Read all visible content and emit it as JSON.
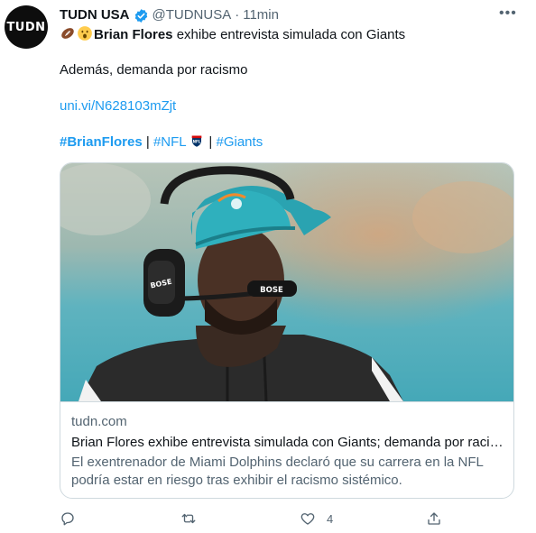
{
  "tweet": {
    "avatar_text": "TUDN",
    "author_name": "TUDN USA",
    "handle": "@TUDNUSA",
    "separator": "·",
    "time": "11min",
    "headline_bold": "Brian Flores",
    "headline_rest": " exhibe entrevista simulada con Giants",
    "body": "Además, demanda por racismo",
    "link": "uni.vi/N628103mZjt",
    "hashtags": [
      "#BrianFlores",
      "#NFL",
      "#Giants"
    ],
    "tag_separator": "|",
    "icons": [
      "verified-badge-icon",
      "football-emoji-icon",
      "surprised-face-emoji-icon",
      "nfl-shield-emoji-icon",
      "more-options-icon"
    ]
  },
  "card": {
    "domain": "tudn.com",
    "title": "Brian Flores exhibe entrevista simulada con Giants; demanda por racismo",
    "description": "El exentrenador de Miami Dolphins declaró que su carrera en la NFL podría estar en riesgo tras exhibir el racismo sistémico.",
    "image_desc": "coach-with-headset-photo"
  },
  "actions": {
    "reply_count": "",
    "retweet_count": "",
    "like_count": "4",
    "icons": [
      "reply-icon",
      "retweet-icon",
      "like-icon",
      "share-icon"
    ]
  },
  "colors": {
    "link_blue": "#1d9bf0",
    "secondary_text": "#536471",
    "border": "#cfd9de"
  }
}
